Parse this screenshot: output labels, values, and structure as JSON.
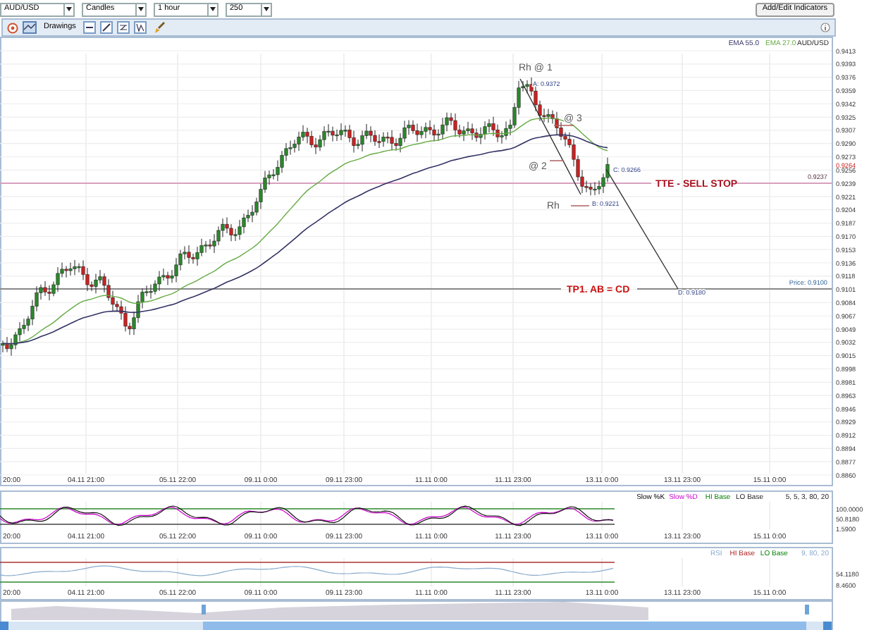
{
  "toolbar": {
    "selects": [
      {
        "value": "AUD/USD"
      },
      {
        "value": "Candles"
      },
      {
        "value": "1 hour"
      },
      {
        "value": "250"
      }
    ],
    "button": "Add/Edit Indicators"
  },
  "drawings_bar": {
    "label": "Drawings"
  },
  "price_chart": {
    "legend": [
      {
        "text": "EMA 55.0"
      },
      {
        "text": "EMA 27.0"
      },
      {
        "text": "AUD/USD"
      }
    ],
    "price_ticks": [
      "0.9413",
      "0.9393",
      "0.9376",
      "0.9359",
      "0.9342",
      "0.9325",
      "0.9307",
      "0.9290",
      "0.9273",
      "0.9256",
      "0.9239",
      "0.9221",
      "0.9204",
      "0.9187",
      "0.9170",
      "0.9153",
      "0.9136",
      "0.9118",
      "0.9101",
      "0.9084",
      "0.9067",
      "0.9049",
      "0.9032",
      "0.9015",
      "0.8998",
      "0.8981",
      "0.8963",
      "0.8946",
      "0.8929",
      "0.8912",
      "0.8894",
      "0.8877",
      "0.8860"
    ],
    "current_price": "0.9264",
    "annotations": [
      {
        "text": "Rh @ 1",
        "kind": "label"
      },
      {
        "text": "A: 0.9372",
        "kind": "point"
      },
      {
        "text": "@ 3",
        "kind": "label"
      },
      {
        "text": "@ 2",
        "kind": "label"
      },
      {
        "text": "Rh",
        "kind": "label"
      },
      {
        "text": "B: 0.9221",
        "kind": "point"
      },
      {
        "text": "C: 0.9266",
        "kind": "point"
      },
      {
        "text": "D: 0.9180",
        "kind": "point"
      }
    ],
    "levels": [
      {
        "label": "TTE - SELL STOP",
        "value": "0.9237"
      },
      {
        "label": "TP1.  AB = CD",
        "value": "Price: 0.9100"
      }
    ],
    "time_ticks": [
      "20:00",
      "04.11 21:00",
      "05.11 22:00",
      "09.11 0:00",
      "09.11 23:00",
      "11.11 0:00",
      "11.11 23:00",
      "13.11 0:00",
      "13.11 23:00",
      "15.11 0:00"
    ]
  },
  "stochastic": {
    "legend": [
      {
        "text": "Slow %K"
      },
      {
        "text": "Slow %D"
      },
      {
        "text": "HI Base"
      },
      {
        "text": "LO Base"
      },
      {
        "text": "5, 5, 3, 80, 20"
      }
    ],
    "ticks": [
      "100.0000",
      "50.8180",
      "1.5900"
    ],
    "time_ticks": [
      "20:00",
      "04.11 21:00",
      "05.11 22:00",
      "09.11 0:00",
      "09.11 23:00",
      "11.11 0:00",
      "11.11 23:00",
      "13.11 0:00",
      "13.11 23:00",
      "15.11 0:00"
    ]
  },
  "rsi": {
    "legend": [
      {
        "text": "RSI"
      },
      {
        "text": "HI Base"
      },
      {
        "text": "LO Base"
      },
      {
        "text": "9, 80, 20"
      }
    ],
    "ticks": [
      "54.1180",
      "8.4600"
    ],
    "time_ticks": [
      "20:00",
      "04.11 21:00",
      "05.11 22:00",
      "09.11 0:00",
      "09.11 23:00",
      "11.11 0:00",
      "11.11 23:00",
      "13.11 0:00",
      "13.11 23:00",
      "15.11 0:00"
    ]
  }
}
